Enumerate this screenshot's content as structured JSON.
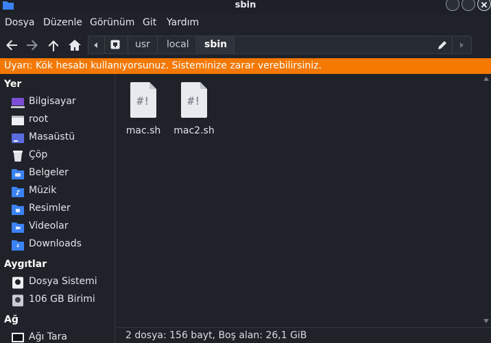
{
  "window": {
    "title": "sbin"
  },
  "menu": [
    "Dosya",
    "Düzenle",
    "Görünüm",
    "Git",
    "Yardım"
  ],
  "path": [
    "usr",
    "local",
    "sbin"
  ],
  "warning": "Uyarı: Kök hesabı kullanıyorsunuz. Sisteminize zarar verebilirsiniz.",
  "sidebar": {
    "places_title": "Yer",
    "places": [
      "Bilgisayar",
      "root",
      "Masaüstü",
      "Çöp",
      "Belgeler",
      "Müzik",
      "Resimler",
      "Videolar",
      "Downloads"
    ],
    "devices_title": "Aygıtlar",
    "devices": [
      "Dosya Sistemi",
      "106 GB Birimi"
    ],
    "network_title": "Ağ",
    "network": [
      "Ağı Tara"
    ]
  },
  "files": [
    {
      "name": "mac.sh",
      "icon": "script-file-icon"
    },
    {
      "name": "mac2.sh",
      "icon": "script-file-icon"
    }
  ],
  "status": "2 dosya: 156 bayt, Boş alan: 26,1 GiB",
  "colors": {
    "warning": "#f57900",
    "folder": "#3b82f6",
    "background": "#1f2229"
  }
}
